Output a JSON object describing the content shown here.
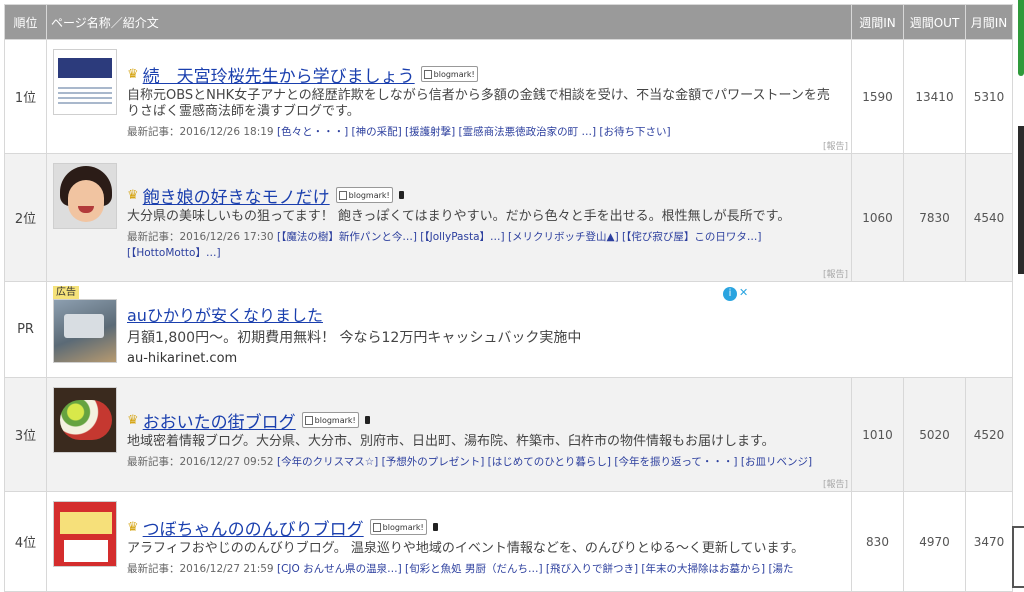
{
  "header": {
    "rank": "順位",
    "name": "ページ名称／紹介文",
    "week_in": "週間IN",
    "week_out": "週間OUT",
    "month_in": "月間IN"
  },
  "labels": {
    "latest": "最新記事：",
    "ad_report": "[報告]",
    "bm": "blogmark!",
    "crown": "♛"
  },
  "rows": [
    {
      "rank": "1位",
      "title": "続　天宮玲桜先生から学びましょう",
      "desc": "自称元OBSとNHK女子アナとの経歴詐欺をしながら信者から多額の金銭で相談を受け、不当な金額でパワーストーンを売りさばく霊感商法師を潰すブログです。",
      "date": "2016/12/26 18:19",
      "articles": "[色々と・・・] [神の采配] [援護射撃] [霊感商法悪徳政治家の町 …] [お待ち下さい]",
      "week_in": "1590",
      "week_out": "13410",
      "month_in": "5310"
    },
    {
      "rank": "2位",
      "title": "飽き娘の好きなモノだけ",
      "desc": "大分県の美味しいもの狙ってます！ 飽きっぽくてはまりやすい。だから色々と手を出せる。根性無しが長所です。",
      "date": "2016/12/26 17:30",
      "articles": "[【魔法の樹】新作パンと今…] [【JollyPasta】…] [メリクリボッチ登山▲] [【侘び寂び屋】この日ワタ…] [【HottoMotto】…]",
      "week_in": "1060",
      "week_out": "7830",
      "month_in": "4540"
    },
    {
      "rank": "3位",
      "title": "おおいたの街ブログ",
      "desc": "地域密着情報ブログ。大分県、大分市、別府市、日出町、湯布院、杵築市、臼杵市の物件情報もお届けします。",
      "date": "2016/12/27 09:52",
      "articles": "[今年のクリスマス☆] [予想外のプレゼント] [はじめてのひとり暮らし] [今年を振り返って・・・] [お皿リベンジ]",
      "week_in": "1010",
      "week_out": "5020",
      "month_in": "4520"
    },
    {
      "rank": "4位",
      "title": "つぼちゃんののんびりブログ",
      "desc": "アラフィフおやじののんびりブログ。 温泉巡りや地域のイベント情報などを、のんびりとゆる～く更新しています。",
      "date": "2016/12/27 21:59",
      "articles": "[CJO おんせん県の温泉…] [旬彩と魚処 男厨（だんち…] [飛び入りで餅つき] [年末の大掃除はお墓から] [湯た",
      "week_in": "830",
      "week_out": "4970",
      "month_in": "3470"
    }
  ],
  "pr": {
    "rank": "PR",
    "badge": "広告",
    "title": "auひかりが安くなりました",
    "desc": "月額1,800円～。初期費用無料！ 今なら12万円キャッシュバック実施中",
    "domain": "au-hikarinet.com",
    "adchoices_i": "i",
    "adchoices_x": "✕"
  },
  "colors": {
    "header_bg": "#9a9a9a",
    "link": "#1a3fae",
    "row_alt": "#f2f2f2"
  }
}
